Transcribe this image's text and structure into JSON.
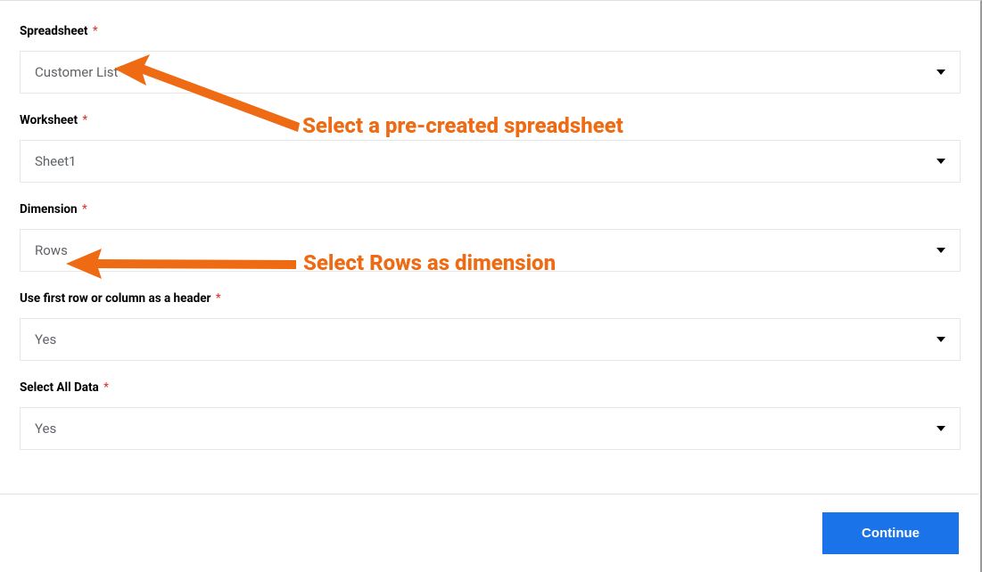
{
  "form": {
    "spreadsheet": {
      "label": "Spreadsheet",
      "value": "Customer List"
    },
    "worksheet": {
      "label": "Worksheet",
      "value": "Sheet1"
    },
    "dimension": {
      "label": "Dimension",
      "value": "Rows"
    },
    "header": {
      "label": "Use first row or column as a header",
      "value": "Yes"
    },
    "selectAll": {
      "label": "Select All Data",
      "value": "Yes"
    }
  },
  "annotations": {
    "spreadsheet_hint": "Select a pre-created spreadsheet",
    "dimension_hint": "Select Rows as dimension"
  },
  "footer": {
    "continue_label": "Continue"
  },
  "colors": {
    "accent_orange": "#ee6a13",
    "primary_blue": "#1a73e8",
    "required_red": "#d93025",
    "text_muted": "#5f6368"
  }
}
